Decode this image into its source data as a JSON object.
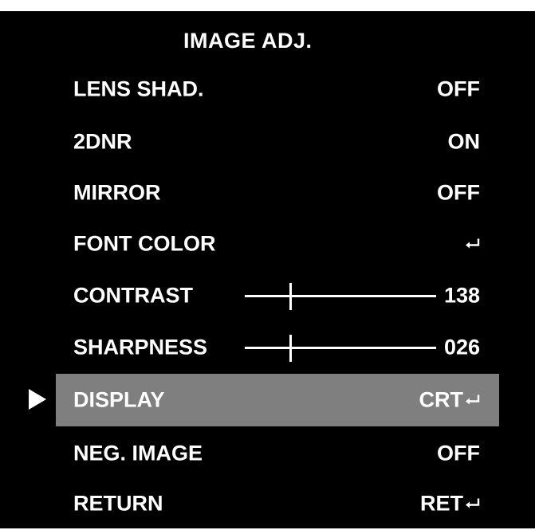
{
  "menu": {
    "title": "IMAGE ADJ.",
    "items": [
      {
        "label": "LENS SHAD.",
        "value": "OFF"
      },
      {
        "label": "2DNR",
        "value": "ON"
      },
      {
        "label": "MIRROR",
        "value": "OFF"
      },
      {
        "label": "FONT COLOR",
        "value": "",
        "enter_icon": "enter-icon"
      },
      {
        "label": "CONTRAST",
        "value": "138",
        "slider_level": 0.24
      },
      {
        "label": "SHARPNESS",
        "value": "026",
        "slider_level": 0.24
      },
      {
        "label": "DISPLAY",
        "value": "CRT",
        "enter_icon": "enter-icon",
        "selected": true
      },
      {
        "label": "NEG. IMAGE",
        "value": "OFF"
      },
      {
        "label": "RETURN",
        "value": "RET",
        "enter_icon": "enter-icon"
      }
    ]
  },
  "colors": {
    "background": "#000000",
    "text": "#ffffff",
    "selected_row": "#7f7f7f"
  },
  "cursor_icon": "triangle-right-icon"
}
